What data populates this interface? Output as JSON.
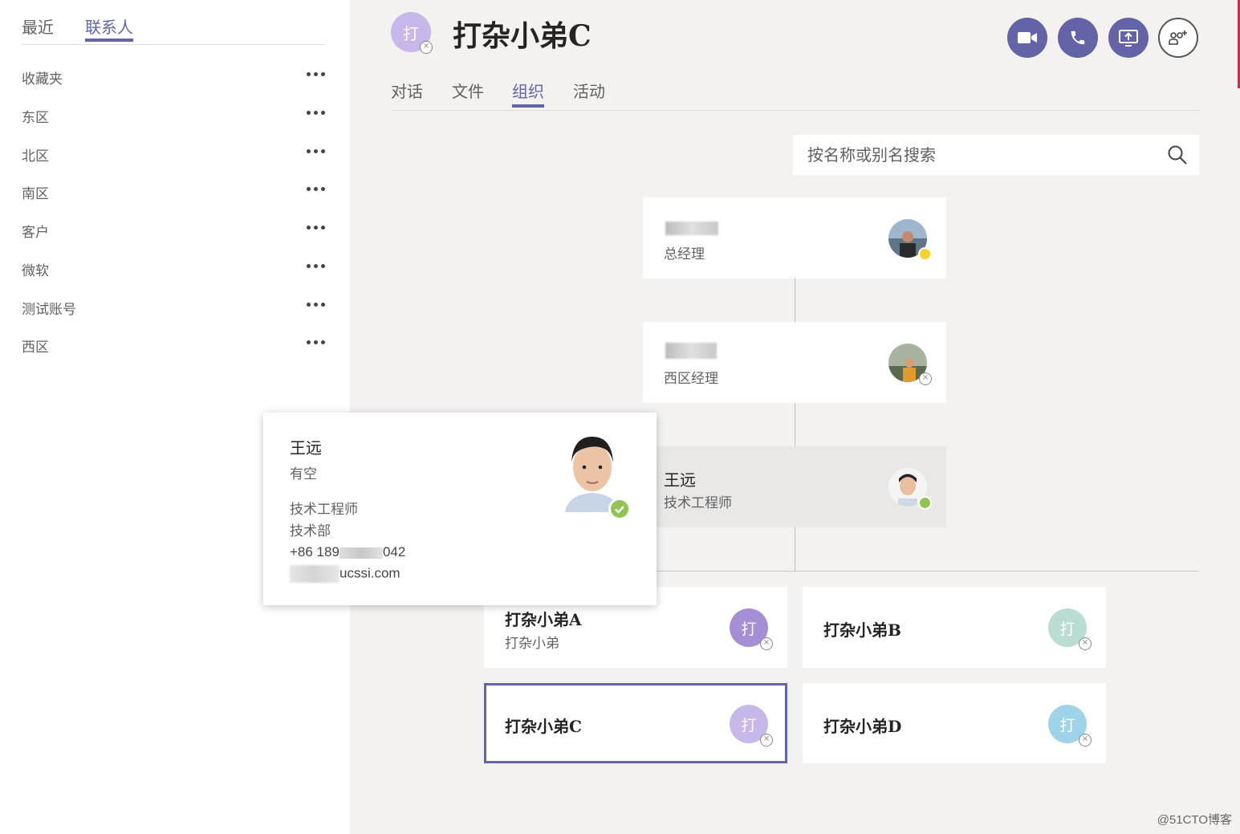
{
  "sidebar": {
    "tabs": [
      {
        "label": "最近"
      },
      {
        "label": "联系人"
      }
    ],
    "groups": [
      {
        "label": "收藏夹"
      },
      {
        "label": "东区"
      },
      {
        "label": "北区"
      },
      {
        "label": "南区"
      },
      {
        "label": "客户"
      },
      {
        "label": "微软"
      },
      {
        "label": "测试账号"
      },
      {
        "label": "西区"
      }
    ]
  },
  "header": {
    "avatar_initial": "打",
    "title": "打杂小弟C",
    "actions": [
      "video-call",
      "audio-call",
      "share-screen",
      "add-people"
    ]
  },
  "tabs": [
    {
      "label": "对话"
    },
    {
      "label": "文件"
    },
    {
      "label": "组织"
    },
    {
      "label": "活动"
    }
  ],
  "search": {
    "placeholder": "按名称或别名搜索"
  },
  "org": {
    "chain": [
      {
        "title": "总经理",
        "status": "away"
      },
      {
        "title": "西区经理",
        "status": "offline"
      },
      {
        "name": "王远",
        "title": "技术工程师",
        "status": "available"
      }
    ],
    "reports": [
      {
        "name": "打杂小弟A",
        "title": "打杂小弟",
        "initial": "打",
        "color": "#a48fd4",
        "status": "offline"
      },
      {
        "name": "打杂小弟B",
        "initial": "打",
        "color": "#b9dcd3",
        "status": "offline"
      },
      {
        "name": "打杂小弟C",
        "initial": "打",
        "color": "#c6b8e8",
        "status": "offline"
      },
      {
        "name": "打杂小弟D",
        "initial": "打",
        "color": "#9ed3ea",
        "status": "offline"
      }
    ]
  },
  "popup": {
    "name": "王远",
    "status": "有空",
    "title": "技术工程师",
    "department": "技术部",
    "phone_start": "+86 189",
    "phone_end": "042",
    "email_end": "ucssi.com"
  },
  "watermark": "@51CTO博客",
  "colors": {
    "accent": "#6264a7",
    "available": "#92c353",
    "away": "#f8d22a"
  }
}
